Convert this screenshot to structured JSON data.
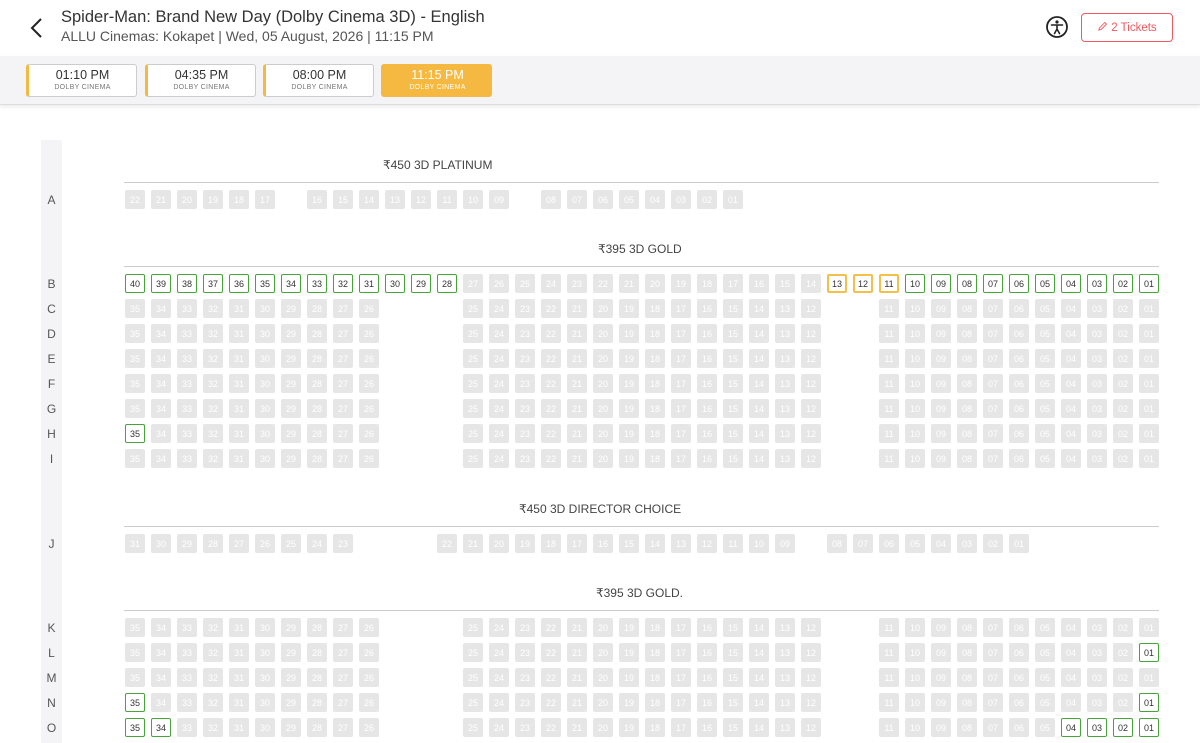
{
  "header": {
    "title": "Spider-Man: Brand New Day (Dolby Cinema 3D) - English",
    "subtitle": "ALLU Cinemas: Kokapet | Wed, 05 August, 2026 | 11:15 PM",
    "tickets_label": "2 Tickets"
  },
  "colors": {
    "available": "#46a43a",
    "selected": "#f5c04a",
    "sold": "#e6e6e6",
    "accent": "#f5b942",
    "tickets": "#f0595f"
  },
  "showtimes": [
    {
      "time": "01:10 PM",
      "format": "DOLBY CINEMA",
      "active": false
    },
    {
      "time": "04:35 PM",
      "format": "DOLBY CINEMA",
      "active": false
    },
    {
      "time": "08:00 PM",
      "format": "DOLBY CINEMA",
      "active": false
    },
    {
      "time": "11:15 PM",
      "format": "DOLBY CINEMA",
      "active": true
    }
  ],
  "sections": [
    {
      "title": "₹450 3D PLATINUM"
    },
    {
      "title": "₹395 3D GOLD"
    },
    {
      "title": "₹450 3D DIRECTOR CHOICE"
    },
    {
      "title": "₹395 3D GOLD."
    }
  ],
  "rows": [
    {
      "label": "A",
      "seats": [
        "22",
        "21",
        "20",
        "19",
        "18",
        "17",
        "16",
        "15",
        "14",
        "13",
        "12",
        "11",
        "10",
        "09",
        "08",
        "07",
        "06",
        "05",
        "04",
        "03",
        "02",
        "01"
      ],
      "available": [],
      "selected": []
    },
    {
      "label": "B",
      "seats": [
        "40",
        "39",
        "38",
        "37",
        "36",
        "35",
        "34",
        "33",
        "32",
        "31",
        "30",
        "29",
        "28",
        "27",
        "26",
        "25",
        "24",
        "23",
        "22",
        "21",
        "20",
        "19",
        "18",
        "17",
        "16",
        "15",
        "14",
        "13",
        "12",
        "11",
        "10",
        "09",
        "08",
        "07",
        "06",
        "05",
        "04",
        "03",
        "02",
        "01"
      ],
      "available": [
        "40",
        "39",
        "38",
        "37",
        "36",
        "35",
        "34",
        "33",
        "32",
        "31",
        "30",
        "29",
        "28",
        "10",
        "09",
        "08",
        "07",
        "06",
        "05",
        "04",
        "03",
        "02",
        "01"
      ],
      "selected": [
        "13",
        "12",
        "11"
      ]
    },
    {
      "label": "C",
      "seats": [
        "35",
        "34",
        "33",
        "32",
        "31",
        "30",
        "29",
        "28",
        "27",
        "26",
        "25",
        "24",
        "23",
        "22",
        "21",
        "20",
        "19",
        "18",
        "17",
        "16",
        "15",
        "14",
        "13",
        "12",
        "11",
        "10",
        "09",
        "08",
        "07",
        "06",
        "05",
        "04",
        "03",
        "02",
        "01"
      ],
      "available": [],
      "selected": []
    },
    {
      "label": "D",
      "seats": [
        "35",
        "34",
        "33",
        "32",
        "31",
        "30",
        "29",
        "28",
        "27",
        "26",
        "25",
        "24",
        "23",
        "22",
        "21",
        "20",
        "19",
        "18",
        "17",
        "16",
        "15",
        "14",
        "13",
        "12",
        "11",
        "10",
        "09",
        "08",
        "07",
        "06",
        "05",
        "04",
        "03",
        "02",
        "01"
      ],
      "available": [],
      "selected": []
    },
    {
      "label": "E",
      "seats": [
        "35",
        "34",
        "33",
        "32",
        "31",
        "30",
        "29",
        "28",
        "27",
        "26",
        "25",
        "24",
        "23",
        "22",
        "21",
        "20",
        "19",
        "18",
        "17",
        "16",
        "15",
        "14",
        "13",
        "12",
        "11",
        "10",
        "09",
        "08",
        "07",
        "06",
        "05",
        "04",
        "03",
        "02",
        "01"
      ],
      "available": [],
      "selected": []
    },
    {
      "label": "F",
      "seats": [
        "35",
        "34",
        "33",
        "32",
        "31",
        "30",
        "29",
        "28",
        "27",
        "26",
        "25",
        "24",
        "23",
        "22",
        "21",
        "20",
        "19",
        "18",
        "17",
        "16",
        "15",
        "14",
        "13",
        "12",
        "11",
        "10",
        "09",
        "08",
        "07",
        "06",
        "05",
        "04",
        "03",
        "02",
        "01"
      ],
      "available": [],
      "selected": []
    },
    {
      "label": "G",
      "seats": [
        "35",
        "34",
        "33",
        "32",
        "31",
        "30",
        "29",
        "28",
        "27",
        "26",
        "25",
        "24",
        "23",
        "22",
        "21",
        "20",
        "19",
        "18",
        "17",
        "16",
        "15",
        "14",
        "13",
        "12",
        "11",
        "10",
        "09",
        "08",
        "07",
        "06",
        "05",
        "04",
        "03",
        "02",
        "01"
      ],
      "available": [],
      "selected": []
    },
    {
      "label": "H",
      "seats": [
        "35",
        "34",
        "33",
        "32",
        "31",
        "30",
        "29",
        "28",
        "27",
        "26",
        "25",
        "24",
        "23",
        "22",
        "21",
        "20",
        "19",
        "18",
        "17",
        "16",
        "15",
        "14",
        "13",
        "12",
        "11",
        "10",
        "09",
        "08",
        "07",
        "06",
        "05",
        "04",
        "03",
        "02",
        "01"
      ],
      "available": [
        "35"
      ],
      "selected": []
    },
    {
      "label": "I",
      "seats": [
        "35",
        "34",
        "33",
        "32",
        "31",
        "30",
        "29",
        "28",
        "27",
        "26",
        "25",
        "24",
        "23",
        "22",
        "21",
        "20",
        "19",
        "18",
        "17",
        "16",
        "15",
        "14",
        "13",
        "12",
        "11",
        "10",
        "09",
        "08",
        "07",
        "06",
        "05",
        "04",
        "03",
        "02",
        "01"
      ],
      "available": [],
      "selected": []
    },
    {
      "label": "J",
      "seats": [
        "31",
        "30",
        "29",
        "28",
        "27",
        "26",
        "25",
        "24",
        "23",
        "22",
        "21",
        "20",
        "19",
        "18",
        "17",
        "16",
        "15",
        "14",
        "13",
        "12",
        "11",
        "10",
        "09",
        "08",
        "07",
        "06",
        "05",
        "04",
        "03",
        "02",
        "01"
      ],
      "available": [],
      "selected": []
    },
    {
      "label": "K",
      "seats": [
        "35",
        "34",
        "33",
        "32",
        "31",
        "30",
        "29",
        "28",
        "27",
        "26",
        "25",
        "24",
        "23",
        "22",
        "21",
        "20",
        "19",
        "18",
        "17",
        "16",
        "15",
        "14",
        "13",
        "12",
        "11",
        "10",
        "09",
        "08",
        "07",
        "06",
        "05",
        "04",
        "03",
        "02",
        "01"
      ],
      "available": [],
      "selected": []
    },
    {
      "label": "L",
      "seats": [
        "35",
        "34",
        "33",
        "32",
        "31",
        "30",
        "29",
        "28",
        "27",
        "26",
        "25",
        "24",
        "23",
        "22",
        "21",
        "20",
        "19",
        "18",
        "17",
        "16",
        "15",
        "14",
        "13",
        "12",
        "11",
        "10",
        "09",
        "08",
        "07",
        "06",
        "05",
        "04",
        "03",
        "02",
        "01"
      ],
      "available": [
        "01"
      ],
      "selected": []
    },
    {
      "label": "M",
      "seats": [
        "35",
        "34",
        "33",
        "32",
        "31",
        "30",
        "29",
        "28",
        "27",
        "26",
        "25",
        "24",
        "23",
        "22",
        "21",
        "20",
        "19",
        "18",
        "17",
        "16",
        "15",
        "14",
        "13",
        "12",
        "11",
        "10",
        "09",
        "08",
        "07",
        "06",
        "05",
        "04",
        "03",
        "02",
        "01"
      ],
      "available": [],
      "selected": []
    },
    {
      "label": "N",
      "seats": [
        "35",
        "34",
        "33",
        "32",
        "31",
        "30",
        "29",
        "28",
        "27",
        "26",
        "25",
        "24",
        "23",
        "22",
        "21",
        "20",
        "19",
        "18",
        "17",
        "16",
        "15",
        "14",
        "13",
        "12",
        "11",
        "10",
        "09",
        "08",
        "07",
        "06",
        "05",
        "04",
        "03",
        "02",
        "01"
      ],
      "available": [
        "35",
        "01"
      ],
      "selected": []
    },
    {
      "label": "O",
      "seats": [
        "35",
        "34",
        "33",
        "32",
        "31",
        "30",
        "29",
        "28",
        "27",
        "26",
        "25",
        "24",
        "23",
        "22",
        "21",
        "20",
        "19",
        "18",
        "17",
        "16",
        "15",
        "14",
        "13",
        "12",
        "11",
        "10",
        "09",
        "08",
        "07",
        "06",
        "05",
        "04",
        "03",
        "02",
        "01"
      ],
      "available": [
        "35",
        "34",
        "04",
        "03",
        "02",
        "01"
      ],
      "selected": []
    }
  ]
}
